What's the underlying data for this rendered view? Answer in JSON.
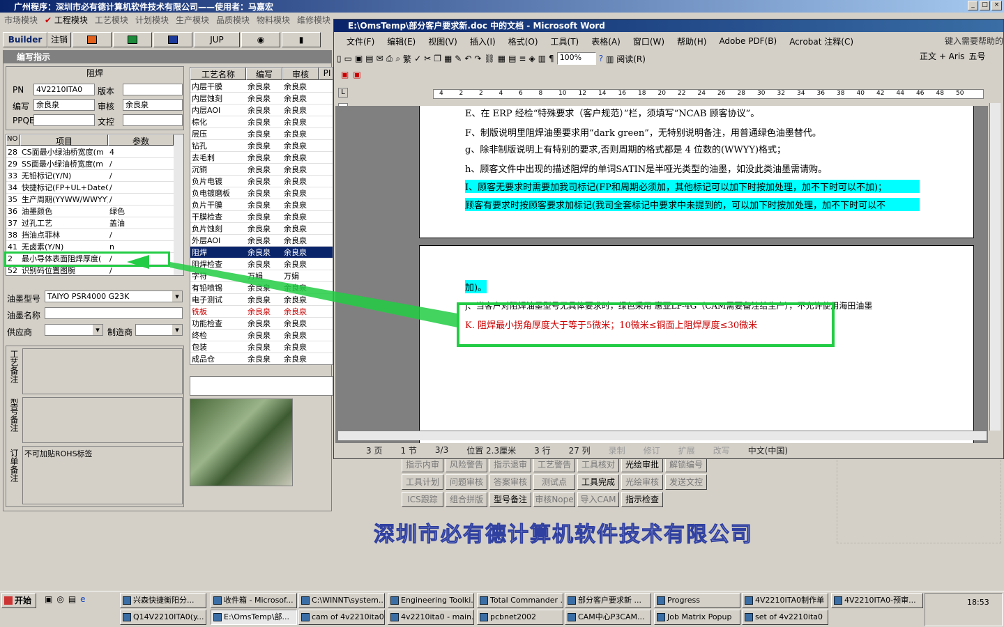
{
  "main_window": {
    "title": "广州程序：深圳市必有德计算机软件技术有限公司——使用者：马嘉宏",
    "menus": [
      "市场模块",
      "工程模块",
      "工艺模块",
      "计划模块",
      "生产模块",
      "品质模块",
      "物料模块",
      "维修模块"
    ],
    "toolbar": {
      "builder": "Builder",
      "logout": "注销",
      "jup": "JUP"
    }
  },
  "panel": {
    "title": "编写指示",
    "section_title": "阻焊",
    "labels": {
      "pn": "PN",
      "version": "版本",
      "writer": "编写",
      "reviewer": "审核",
      "ppqe": "PPQE",
      "document": "文控"
    },
    "pn_value": "4V2210ITA0",
    "writer_value": "余良泉",
    "reviewer_value": "余良泉",
    "param_headers": [
      "NO",
      "项目",
      "参数"
    ],
    "params": [
      {
        "no": "28",
        "item": "CS面最小绿油桥宽度(m",
        "value": "4"
      },
      {
        "no": "29",
        "item": "SS面最小绿油桥宽度(m",
        "value": "/"
      },
      {
        "no": "33",
        "item": "无铅标记(Y/N)",
        "value": "/"
      },
      {
        "no": "34",
        "item": "快捷标记(FP+UL+DateCo",
        "value": "/"
      },
      {
        "no": "35",
        "item": "生产周期(YYWW/WWYY)",
        "value": "/"
      },
      {
        "no": "36",
        "item": "油墨颜色",
        "value": "绿色"
      },
      {
        "no": "37",
        "item": "过孔工艺",
        "value": "盖油"
      },
      {
        "no": "38",
        "item": "挡油点菲林",
        "value": "/"
      },
      {
        "no": "41",
        "item": "无卤素(Y/N)",
        "value": "n"
      },
      {
        "no": "2",
        "item": "最小导体表面阻焊厚度(",
        "value": "/"
      },
      {
        "no": "52",
        "item": "识别码位置图腕",
        "value": "/"
      }
    ],
    "ink_model_label": "油墨型号",
    "ink_model_value": "TAIYO PSR4000 G23K",
    "ink_name_label": "油墨名称",
    "supplier_label": "供应商",
    "maker_label": "制造商",
    "note_labels": [
      "工艺备注",
      "型号备注",
      "订单备注"
    ],
    "order_note": "不可加贴ROHS标签",
    "process_headers": [
      "工艺名称",
      "编写",
      "审核",
      "PI"
    ],
    "processes": [
      {
        "name": "内层干膜",
        "w": "余良泉",
        "r": "余良泉"
      },
      {
        "name": "内层蚀刻",
        "w": "余良泉",
        "r": "余良泉"
      },
      {
        "name": "内层AOI",
        "w": "余良泉",
        "r": "余良泉"
      },
      {
        "name": "棕化",
        "w": "余良泉",
        "r": "余良泉"
      },
      {
        "name": "层压",
        "w": "余良泉",
        "r": "余良泉"
      },
      {
        "name": "钻孔",
        "w": "余良泉",
        "r": "余良泉"
      },
      {
        "name": "去毛刺",
        "w": "余良泉",
        "r": "余良泉"
      },
      {
        "name": "沉铜",
        "w": "余良泉",
        "r": "余良泉"
      },
      {
        "name": "负片电镀",
        "w": "余良泉",
        "r": "余良泉"
      },
      {
        "name": "负电镀磨板",
        "w": "余良泉",
        "r": "余良泉"
      },
      {
        "name": "负片干膜",
        "w": "余良泉",
        "r": "余良泉"
      },
      {
        "name": "干膜检查",
        "w": "余良泉",
        "r": "余良泉"
      },
      {
        "name": "负片蚀刻",
        "w": "余良泉",
        "r": "余良泉"
      },
      {
        "name": "外层AOI",
        "w": "余良泉",
        "r": "余良泉"
      },
      {
        "name": "阻焊",
        "w": "余良泉",
        "r": "余良泉"
      },
      {
        "name": "阻焊检查",
        "w": "余良泉",
        "r": "余良泉"
      },
      {
        "name": "字符",
        "w": "万娟",
        "r": "万娟"
      },
      {
        "name": "有铅喷锡",
        "w": "余良泉",
        "r": "余良泉"
      },
      {
        "name": "电子测试",
        "w": "余良泉",
        "r": "余良泉"
      },
      {
        "name": "铣板",
        "w": "余良泉",
        "r": "余良泉"
      },
      {
        "name": "功能检查",
        "w": "余良泉",
        "r": "余良泉"
      },
      {
        "name": "终检",
        "w": "余良泉",
        "r": "余良泉"
      },
      {
        "name": "包装",
        "w": "余良泉",
        "r": "余良泉"
      },
      {
        "name": "成品仓",
        "w": "余良泉",
        "r": "余良泉"
      }
    ]
  },
  "bottom_buttons": [
    "指示内审",
    "风险警告",
    "指示退审",
    "工艺警告",
    "工具核对",
    "光绘审批",
    "解锁编号",
    "工具计划",
    "问题审核",
    "答案审核",
    "测试点",
    "工具完成",
    "光绘审核",
    "发送文控",
    "ICS跟踪",
    "组合拼版",
    "型号备注",
    "审核Nope",
    "导入CAM",
    "指示检查"
  ],
  "company_banner": "深圳市必有德计算机软件技术有限公司",
  "word": {
    "title": "E:\\OmsTemp\\部分客户要求新.doc 中的文档 - Microsoft Word",
    "menus": [
      "文件(F)",
      "编辑(E)",
      "视图(V)",
      "插入(I)",
      "格式(O)",
      "工具(T)",
      "表格(A)",
      "窗口(W)",
      "帮助(H)",
      "Adobe PDF(B)",
      "Acrobat 注释(C)"
    ],
    "help_box": "键入需要帮助的",
    "zoom": "100%",
    "read_btn": "阅读(R)",
    "style": "正文 + Aris",
    "font_size": "五号",
    "ruler": [
      "4",
      "2",
      "2",
      "4",
      "6",
      "8",
      "10",
      "12",
      "14",
      "16",
      "18",
      "20",
      "22",
      "24",
      "26",
      "28",
      "30",
      "32",
      "34",
      "36",
      "38",
      "40",
      "42",
      "44",
      "46",
      "48",
      "50"
    ],
    "lines": [
      "E、在 ERP 经检“特殊要求（客户规范）”栏，须填写“NCAB 顾客协议”。",
      "F、制版说明里阻焊油墨要求用“dark green”，无特别说明备注，用普通绿色油墨替代。",
      "g、除非制版说明上有特别的要求,否则周期的格式都是 4 位数的(WWYY)格式；",
      "h、顾客文件中出现的描述阻焊的单词SATIN是半哑光类型的油墨，如没此类油墨需请购。",
      "I、顾客无要求时需要加我司标记(FP和周期必须加，其他标记可以加下时按加处理，加不下时可以不加)；",
      "顾客有要求时按顾客要求加标记(我司全套标记中要求中未提到的，可以加下时按加处理，加不下时可以不",
      "加)。",
      "j、当客户对阻焊油墨型号无具体要求时，绿色采用 惠亚LP-4G（CAM需要备注给生产），不允许使用海田油墨",
      "K. 阻焊最小拐角厚度大于等于5微米；10微米≤铜面上阻焊厚度≤30微米"
    ],
    "status": [
      "3 页",
      "1 节",
      "3/3",
      "位置 2.3厘米",
      "3 行",
      "27 列",
      "录制",
      "修订",
      "扩展",
      "改写",
      "中文(中国)"
    ]
  },
  "taskbar": {
    "start": "开始",
    "clock": "18:53",
    "row1": [
      "兴森快捷衡阳分...",
      "收件箱 - Microsof...",
      "C:\\WINNT\\system...",
      "Engineering Toolki...",
      "Total Commander ...",
      "部分客户要求新 ...",
      "Progress",
      "4V2210ITA0制作单",
      "4V2210ITA0-预审..."
    ],
    "row2": [
      "Q14V2210ITA0(y...",
      "E:\\OmsTemp\\部...",
      "cam of 4v2210ita0",
      "4v2210ita0 - main...",
      "pcbnet2002",
      "CAM中心P3CAM...",
      "Job Matrix Popup",
      "set of 4v2210ita0"
    ]
  },
  "colors": {
    "highlight": "#00ffff",
    "callout": "#22cc44",
    "red_text": "#cc0000",
    "selected_row": "#0a246a"
  }
}
